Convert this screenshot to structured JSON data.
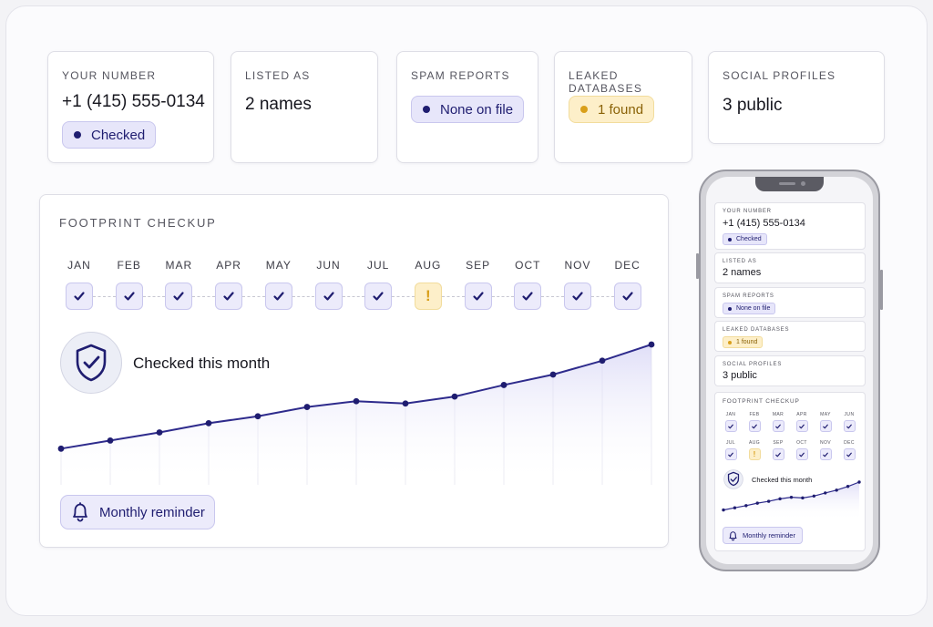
{
  "colors": {
    "accent": "#1f1d70",
    "line": "#2e2b8c",
    "pill_blue_bg": "#e7e6fa",
    "pill_yellow_bg": "#fdefc9",
    "warning": "#d99f1a"
  },
  "stats": [
    {
      "label": "YOUR NUMBER",
      "value": "+1 (415) 555-0134",
      "pill": "Checked",
      "pill_style": "blue"
    },
    {
      "label": "LISTED AS",
      "value": "2 names"
    },
    {
      "label": "SPAM REPORTS",
      "pill": "None on file",
      "pill_style": "blue"
    },
    {
      "label": "LEAKED DATABASES",
      "pill": "1 found",
      "pill_style": "yellow"
    },
    {
      "label": "SOCIAL PROFILES",
      "value": "3 public"
    }
  ],
  "footprint": {
    "title": "FOOTPRINT CHECKUP",
    "months": [
      {
        "label": "JAN",
        "status": "check"
      },
      {
        "label": "FEB",
        "status": "check"
      },
      {
        "label": "MAR",
        "status": "check"
      },
      {
        "label": "APR",
        "status": "check"
      },
      {
        "label": "MAY",
        "status": "check"
      },
      {
        "label": "JUN",
        "status": "check"
      },
      {
        "label": "JUL",
        "status": "check"
      },
      {
        "label": "AUG",
        "status": "warning"
      },
      {
        "label": "SEP",
        "status": "check"
      },
      {
        "label": "OCT",
        "status": "check"
      },
      {
        "label": "NOV",
        "status": "check"
      },
      {
        "label": "DEC",
        "status": "check"
      }
    ],
    "status_text": "Checked this month",
    "reminder_label": "Monthly reminder",
    "warning_glyph": "!"
  },
  "chart_data": {
    "type": "area",
    "title": "",
    "xlabel": "",
    "ylabel": "",
    "x": [
      1,
      2,
      3,
      4,
      5,
      6,
      7,
      8,
      9,
      10,
      11,
      12,
      13
    ],
    "series": [
      {
        "values": [
          10,
          17,
          24,
          32,
          38,
          46,
          51,
          49,
          55,
          65,
          74,
          86,
          100
        ]
      }
    ],
    "ylim": [
      0,
      100
    ],
    "grid": true
  },
  "phone": {
    "footprint_title": "FOOTPRINT CHECKUP",
    "status_text": "Checked this month",
    "reminder_label": "Monthly reminder"
  }
}
